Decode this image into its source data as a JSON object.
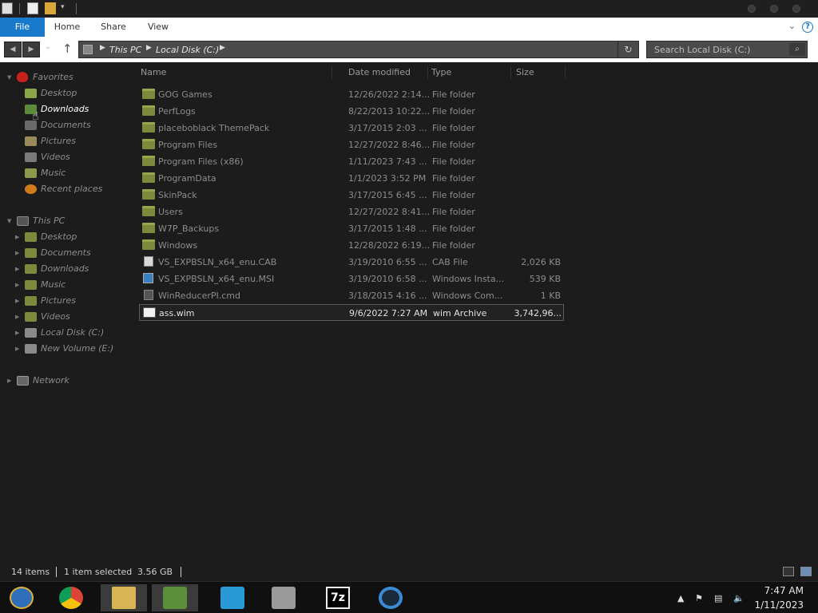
{
  "ribbon": {
    "tabs": [
      "File",
      "Home",
      "Share",
      "View"
    ]
  },
  "address": {
    "segments": [
      "This PC",
      "Local Disk (C:)"
    ]
  },
  "search": {
    "placeholder": "Search Local Disk (C:)"
  },
  "nav": {
    "favorites_label": "Favorites",
    "favorites": [
      "Desktop",
      "Downloads",
      "Documents",
      "Pictures",
      "Videos",
      "Music",
      "Recent places"
    ],
    "thispc_label": "This PC",
    "thispc": [
      "Desktop",
      "Documents",
      "Downloads",
      "Music",
      "Pictures",
      "Videos",
      "Local Disk (C:)",
      "New Volume (E:)"
    ],
    "network_label": "Network"
  },
  "columns": [
    "Name",
    "Date modified",
    "Type",
    "Size"
  ],
  "files": [
    {
      "name": "GOG Games",
      "date": "12/26/2022 2:14...",
      "type": "File folder",
      "size": "",
      "icon": "folder-icon"
    },
    {
      "name": "PerfLogs",
      "date": "8/22/2013 10:22...",
      "type": "File folder",
      "size": "",
      "icon": "folder-icon"
    },
    {
      "name": "placeboblack ThemePack",
      "date": "3/17/2015 2:03 ...",
      "type": "File folder",
      "size": "",
      "icon": "folder-icon"
    },
    {
      "name": "Program Files",
      "date": "12/27/2022 8:46...",
      "type": "File folder",
      "size": "",
      "icon": "folder-icon"
    },
    {
      "name": "Program Files (x86)",
      "date": "1/11/2023 7:43 ...",
      "type": "File folder",
      "size": "",
      "icon": "folder-icon"
    },
    {
      "name": "ProgramData",
      "date": "1/1/2023 3:52 PM",
      "type": "File folder",
      "size": "",
      "icon": "folder-icon"
    },
    {
      "name": "SkinPack",
      "date": "3/17/2015 6:45 ...",
      "type": "File folder",
      "size": "",
      "icon": "folder-icon"
    },
    {
      "name": "Users",
      "date": "12/27/2022 8:41...",
      "type": "File folder",
      "size": "",
      "icon": "folder-icon"
    },
    {
      "name": "W7P_Backups",
      "date": "3/17/2015 1:48 ...",
      "type": "File folder",
      "size": "",
      "icon": "folder-icon"
    },
    {
      "name": "Windows",
      "date": "12/28/2022 6:19...",
      "type": "File folder",
      "size": "",
      "icon": "folder-icon"
    },
    {
      "name": "VS_EXPBSLN_x64_enu.CAB",
      "date": "3/19/2010 6:55 ...",
      "type": "CAB File",
      "size": "2,026 KB",
      "icon": "cab-file-icon"
    },
    {
      "name": "VS_EXPBSLN_x64_enu.MSI",
      "date": "3/19/2010 6:58 ...",
      "type": "Windows Insta...",
      "size": "539 KB",
      "icon": "msi-file-icon"
    },
    {
      "name": "WinReducerPI.cmd",
      "date": "3/18/2015 4:16 ...",
      "type": "Windows Com...",
      "size": "1 KB",
      "icon": "cmd-file-icon"
    },
    {
      "name": "ass.wim",
      "date": "9/6/2022 7:27 AM",
      "type": "wim Archive",
      "size": "3,742,96...",
      "icon": "wim-file-icon",
      "selected": true
    }
  ],
  "status": {
    "items": "14 items",
    "selected": "1 item selected",
    "size": "3.56 GB"
  },
  "clock": {
    "time": "7:47 AM",
    "date": "1/11/2023"
  },
  "taskbar": {
    "apps": [
      "start-orb-icon",
      "chrome-icon",
      "file-explorer-icon",
      "themes-icon",
      "transfer-icon",
      "installer-icon",
      "7zip-icon",
      "app-ring-icon"
    ],
    "sevenzip_label": "7z"
  }
}
